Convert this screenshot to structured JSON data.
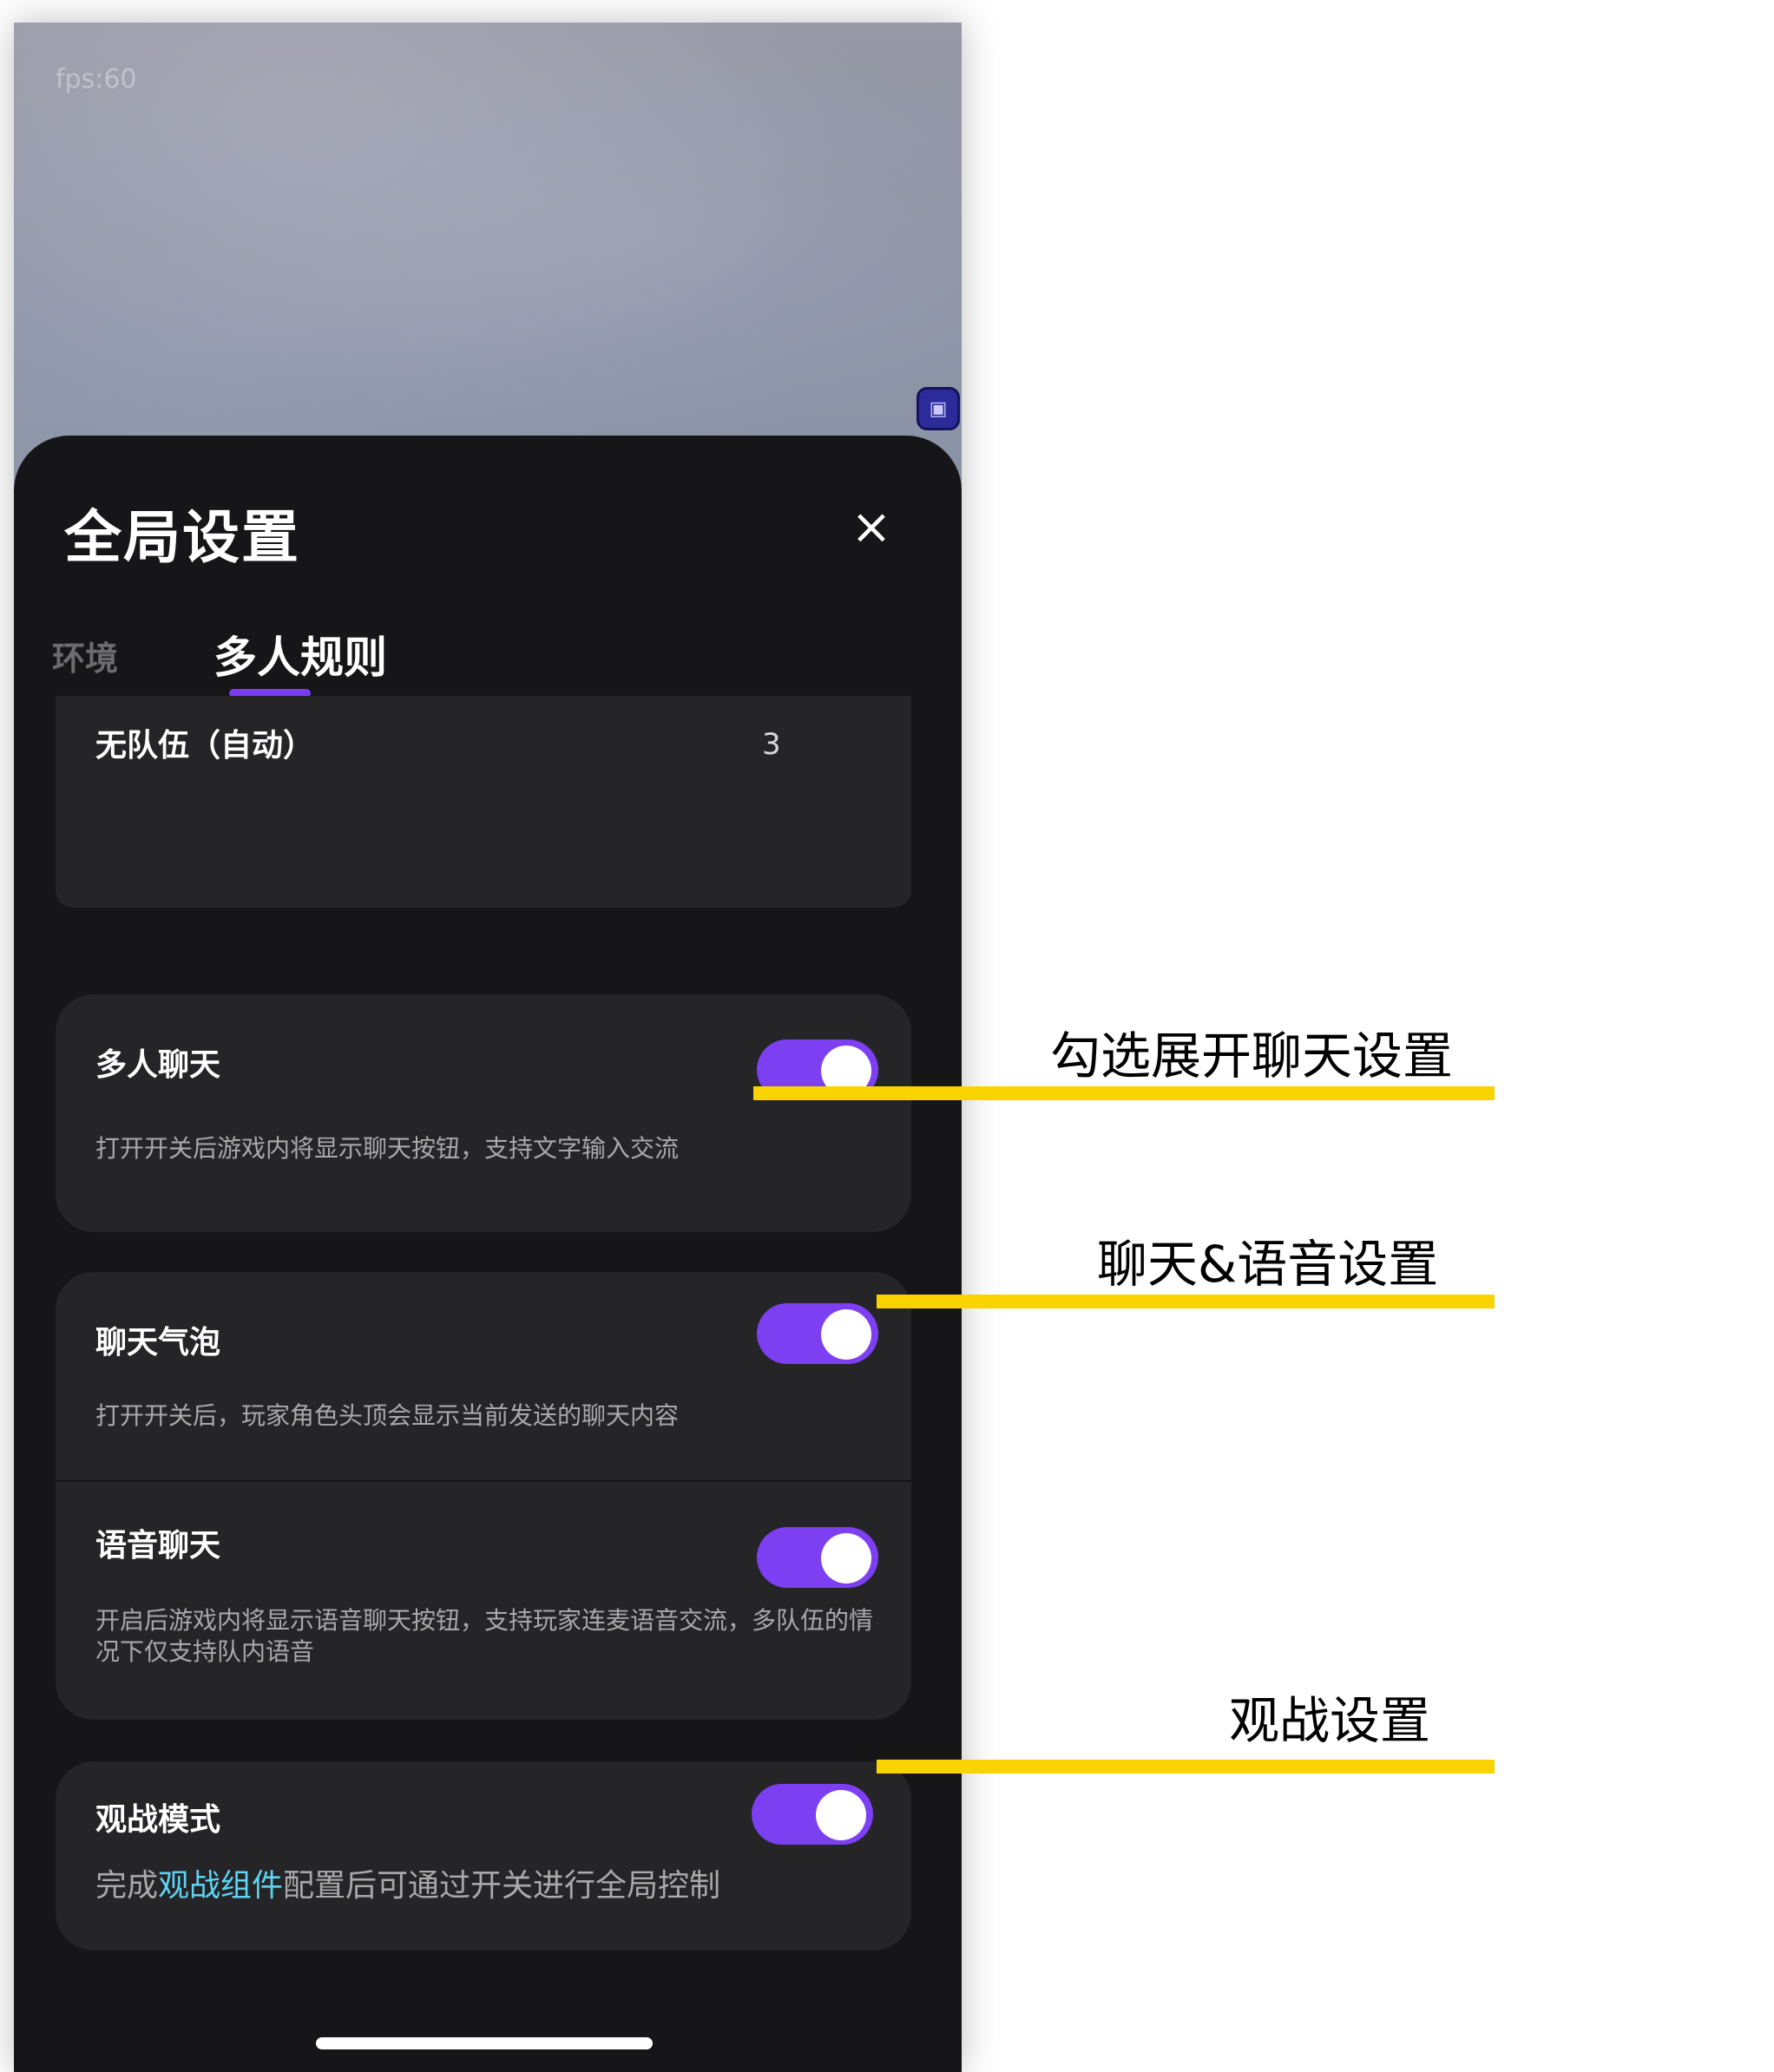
{
  "scene": {
    "fps_label": "fps:60"
  },
  "sheet": {
    "title": "全局设置",
    "close_icon": "×",
    "tabs": [
      {
        "label": "环境",
        "active": false
      },
      {
        "label": "多人规则",
        "active": true
      }
    ]
  },
  "team_row": {
    "label": "无队伍（自动）",
    "count": "3"
  },
  "settings": [
    {
      "title": "多人聊天",
      "desc": "打开开关后游戏内将显示聊天按钮，支持文字输入交流",
      "enabled": true
    },
    {
      "title": "聊天气泡",
      "desc": "打开开关后，玩家角色头顶会显示当前发送的聊天内容",
      "enabled": true
    },
    {
      "title": "语音聊天",
      "desc": "开启后游戏内将显示语音聊天按钮，支持玩家连麦语音交流，多队伍的情况下仅支持队内语音",
      "enabled": true
    },
    {
      "title": "观战模式",
      "desc_before": "完成",
      "desc_link": "观战组件",
      "desc_after": "配置后可通过开关进行全局控制",
      "enabled": true
    }
  ],
  "annotations": [
    {
      "text": "勾选展开聊天设置"
    },
    {
      "text": "聊天&语音设置"
    },
    {
      "text": "观战设置"
    }
  ],
  "colors": {
    "accent_purple": "#7c3ff2",
    "annotation_yellow": "#fad400",
    "link_cyan": "#5fd3f2",
    "sheet_bg": "#161618",
    "card_bg": "#252527"
  }
}
